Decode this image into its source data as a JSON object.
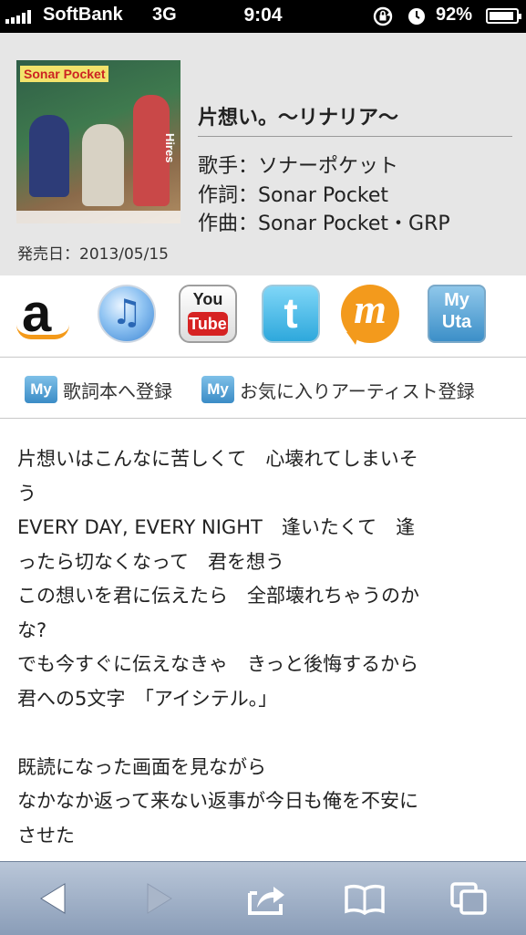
{
  "status_bar": {
    "carrier": "SoftBank",
    "network": "3G",
    "time": "9:04",
    "battery": "92%",
    "battery_level": 0.92
  },
  "song": {
    "cover_label": "Sonar Pocket",
    "cover_side_text": "Hires",
    "title": "片想い。〜リナリア〜",
    "singer": "歌手：ソナーポケット",
    "lyricist": "作詞：Sonar Pocket",
    "composer": "作曲：Sonar Pocket・GRP",
    "release": "発売日：2013/05/15"
  },
  "share_icons": [
    {
      "name": "amazon-icon",
      "glyph": "a"
    },
    {
      "name": "itunes-icon",
      "glyph": "♫"
    },
    {
      "name": "youtube-icon",
      "glyph_top": "You",
      "glyph_bottom": "Tube"
    },
    {
      "name": "twitter-icon",
      "glyph": "t"
    },
    {
      "name": "mixi-icon",
      "glyph": "m"
    },
    {
      "name": "myuta-icon",
      "glyph_top": "My",
      "glyph_bottom": "Uta"
    }
  ],
  "actions": {
    "badge": "My",
    "lyric_book": "歌詞本へ登録",
    "favorite_artist": "お気に入りアーティスト登録"
  },
  "lyrics": [
    "片想いはこんなに苦しくて　心壊れてしまいそ",
    "う",
    "EVERY DAY, EVERY NIGHT　逢いたくて　逢",
    "ったら切なくなって　君を想う",
    "この想いを君に伝えたら　全部壊れちゃうのか",
    "な?",
    "でも今すぐに伝えなきゃ　きっと後悔するから",
    "君への5文字　「アイシテル。」",
    "",
    "既読になった画面を見ながら",
    "なかなか返って来ない返事が今日も俺を不安に",
    "させた"
  ],
  "toolbar": [
    "back-icon",
    "forward-icon",
    "share-icon",
    "bookmarks-icon",
    "tabs-icon"
  ],
  "colors": {
    "header_bg": "#e6e6e6",
    "toolbar": "#9fb0c8",
    "badge": "#3b8cc6"
  }
}
